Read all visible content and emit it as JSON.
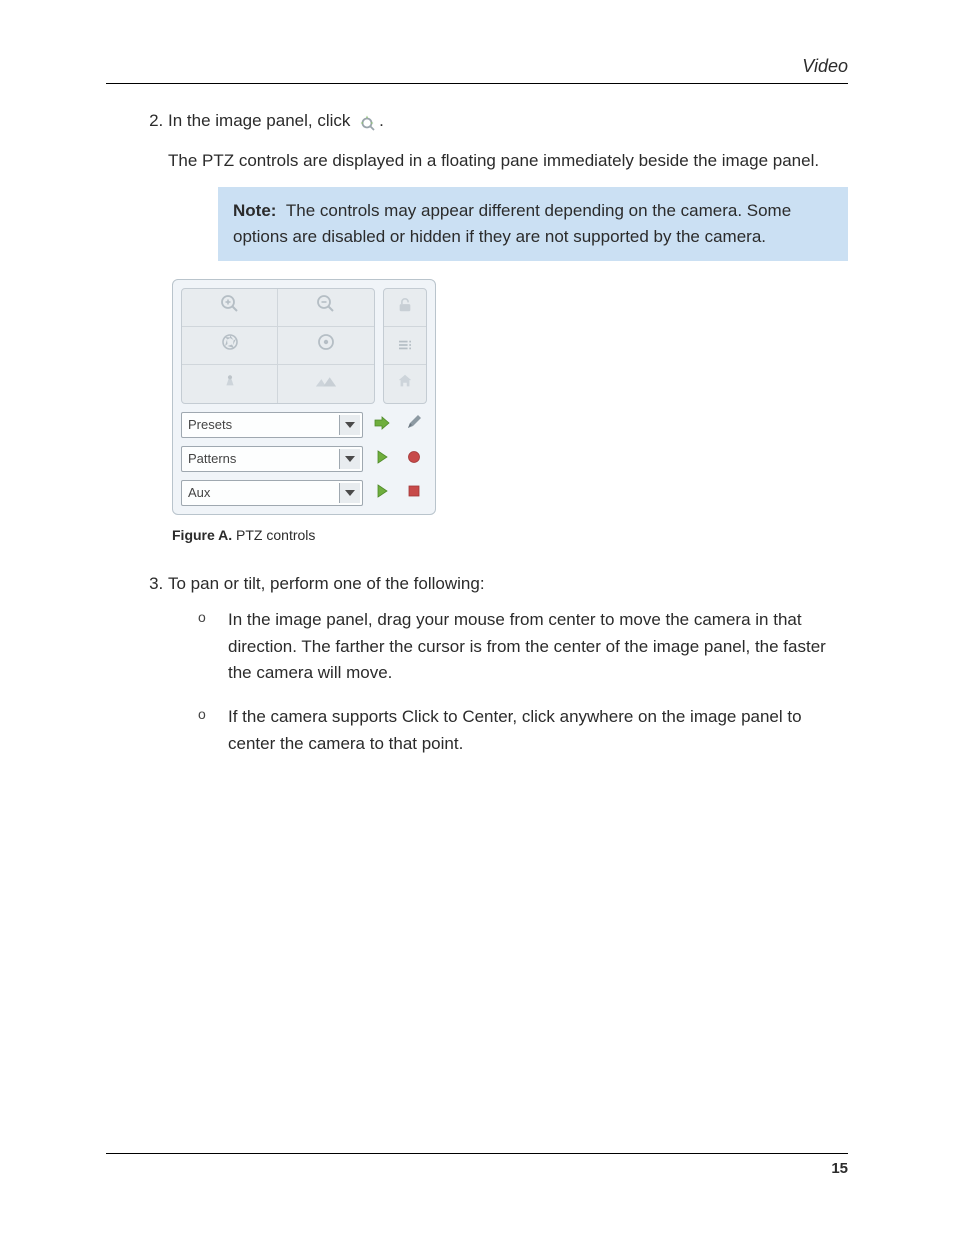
{
  "header": {
    "title": "Video"
  },
  "step2": {
    "number": "2.",
    "text_before_icon": "In the image panel, click ",
    "text_after_icon": ".",
    "description": "The PTZ controls are displayed in a floating pane immediately beside the image panel."
  },
  "note": {
    "label": "Note:",
    "text": "The controls may appear different depending on the camera. Some options are disabled or hidden if they are not supported by the camera."
  },
  "ptz_panel": {
    "dropdowns": [
      {
        "label": "Presets"
      },
      {
        "label": "Patterns"
      },
      {
        "label": "Aux"
      }
    ]
  },
  "figure": {
    "label": "Figure A.",
    "caption": "PTZ controls"
  },
  "step3": {
    "number": "3.",
    "text": "To pan or tilt, perform one of the following:",
    "bullets": [
      "In the image panel, drag your mouse from center to move the camera in that direction. The farther the cursor is from the center of the image panel, the faster the camera will move.",
      "If the camera supports Click to Center, click anywhere on the image panel to center the camera to that point."
    ]
  },
  "footer": {
    "page_number": "15"
  }
}
